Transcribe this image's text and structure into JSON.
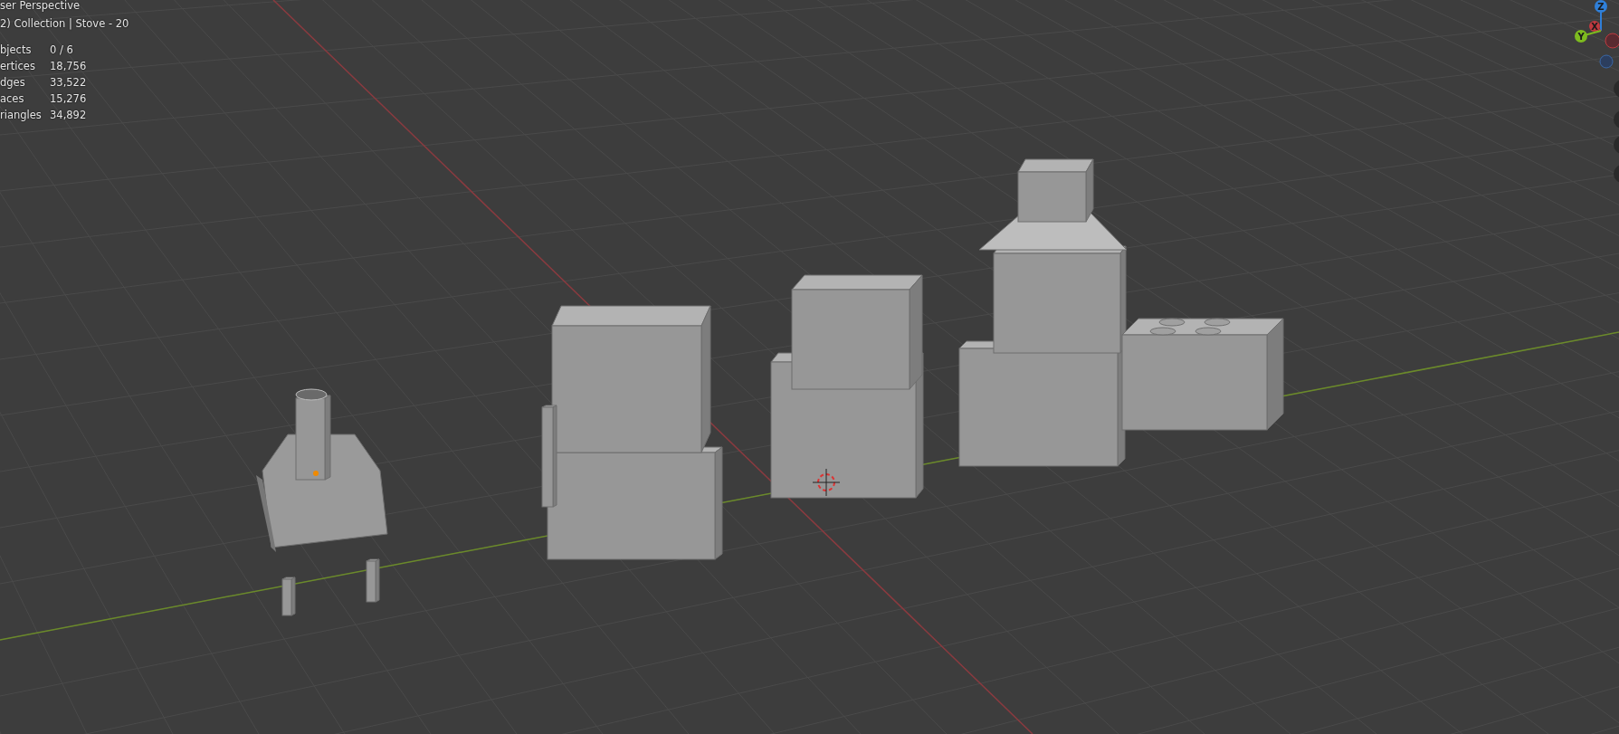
{
  "viewport": {
    "view_name": "ser Perspective",
    "collection": "2) Collection | Stove - 20",
    "stats": [
      {
        "label": "bjects",
        "value": "0 / 6"
      },
      {
        "label": "ertices",
        "value": "18,756"
      },
      {
        "label": "dges",
        "value": "33,522"
      },
      {
        "label": "aces",
        "value": "15,276"
      },
      {
        "label": "riangles",
        "value": "34,892"
      }
    ]
  },
  "gizmo": {
    "axes": [
      {
        "label": "Z",
        "color": "#2f7fd8"
      },
      {
        "label": "X",
        "color": "#c0393f"
      },
      {
        "label": "Y",
        "color": "#7dbb1f"
      }
    ]
  }
}
